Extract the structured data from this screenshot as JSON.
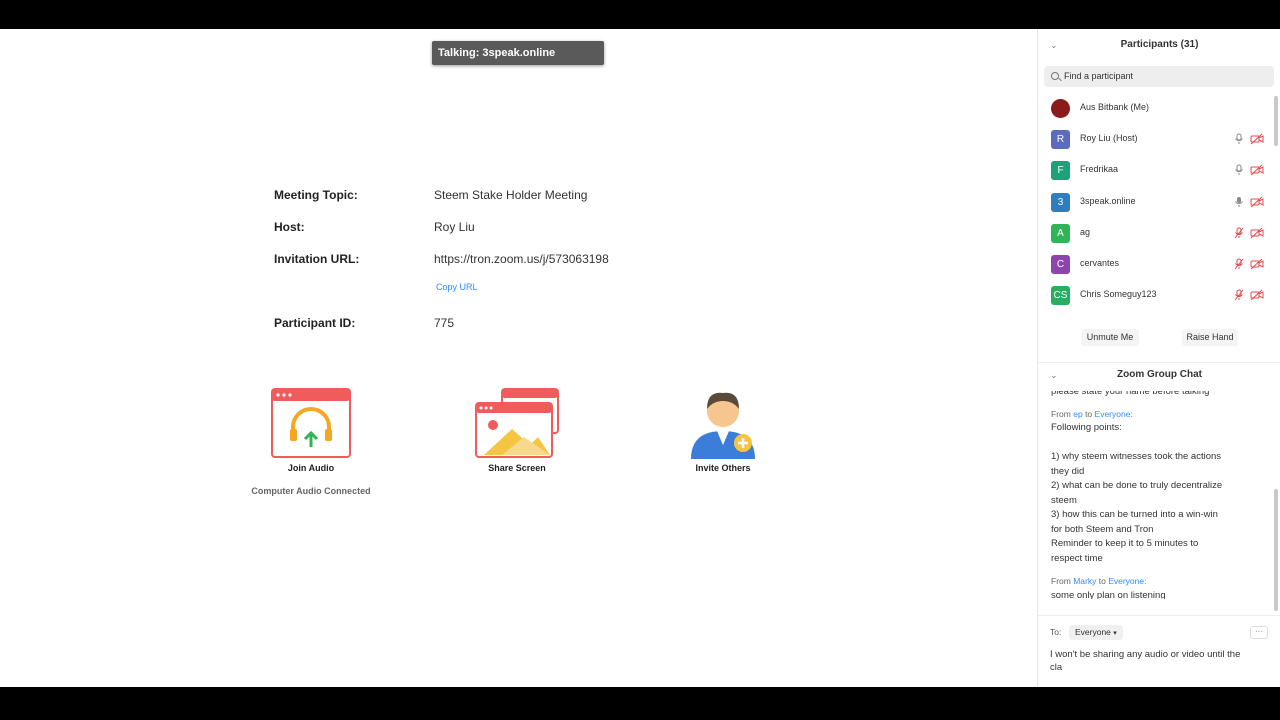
{
  "talking": "Talking: 3speak.online",
  "meeting": {
    "topic_label": "Meeting Topic:",
    "topic": "Steem Stake Holder Meeting",
    "host_label": "Host:",
    "host": "Roy Liu",
    "url_label": "Invitation URL:",
    "url": "https://tron.zoom.us/j/573063198",
    "copy_url": "Copy URL",
    "pid_label": "Participant ID:",
    "pid": "775"
  },
  "actions": {
    "join_audio": "Join Audio",
    "audio_status": "Computer Audio Connected",
    "share_screen": "Share Screen",
    "invite_others": "Invite Others"
  },
  "participants": {
    "title": "Participants (31)",
    "search_placeholder": "Find a participant",
    "items": [
      {
        "initial": "",
        "name": "Aus Bitbank (Me)",
        "color": "#c62828",
        "mic": "muted",
        "cam": "none"
      },
      {
        "initial": "R",
        "name": "Roy Liu (Host)",
        "color": "#5c6bc0",
        "mic": "on",
        "cam": "off"
      },
      {
        "initial": "F",
        "name": "Fredrikaa",
        "color": "#1aa37a",
        "mic": "on",
        "cam": "off"
      },
      {
        "initial": "3",
        "name": "3speak.online",
        "color": "#2e7dbf",
        "mic": "talking",
        "cam": "off"
      },
      {
        "initial": "A",
        "name": "ag",
        "color": "#2fb457",
        "mic": "muted",
        "cam": "off"
      },
      {
        "initial": "C",
        "name": "cervantes",
        "color": "#8e44ad",
        "mic": "muted",
        "cam": "off"
      },
      {
        "initial": "CS",
        "name": "Chris Someguy123",
        "color": "#27ae60",
        "mic": "muted",
        "cam": "off"
      }
    ],
    "unmute": "Unmute Me",
    "raise_hand": "Raise Hand"
  },
  "chat": {
    "title": "Zoom Group Chat",
    "partial": "please state your name before talking",
    "msg1_from": "From",
    "msg1_sender": "ep",
    "msg1_to": "to",
    "msg1_target": "Everyone:",
    "msg1_lines": [
      "Following points:",
      "",
      "1) why steem witnesses took the actions",
      "they did",
      "2) what can be done to truly decentralize",
      "steem",
      "3) how this can be turned into a win-win",
      "for both Steem and Tron",
      "Reminder to keep it to 5 minutes to",
      "respect time"
    ],
    "msg2_from": "From",
    "msg2_sender": "Marky",
    "msg2_to": "to",
    "msg2_target": "Everyone:",
    "msg2_text": "some only plan on listening",
    "to_label": "To:",
    "to_value": "Everyone",
    "more": "···",
    "compose_line1": "I won't be sharing any audio or video until the",
    "compose_line2": "cla"
  }
}
